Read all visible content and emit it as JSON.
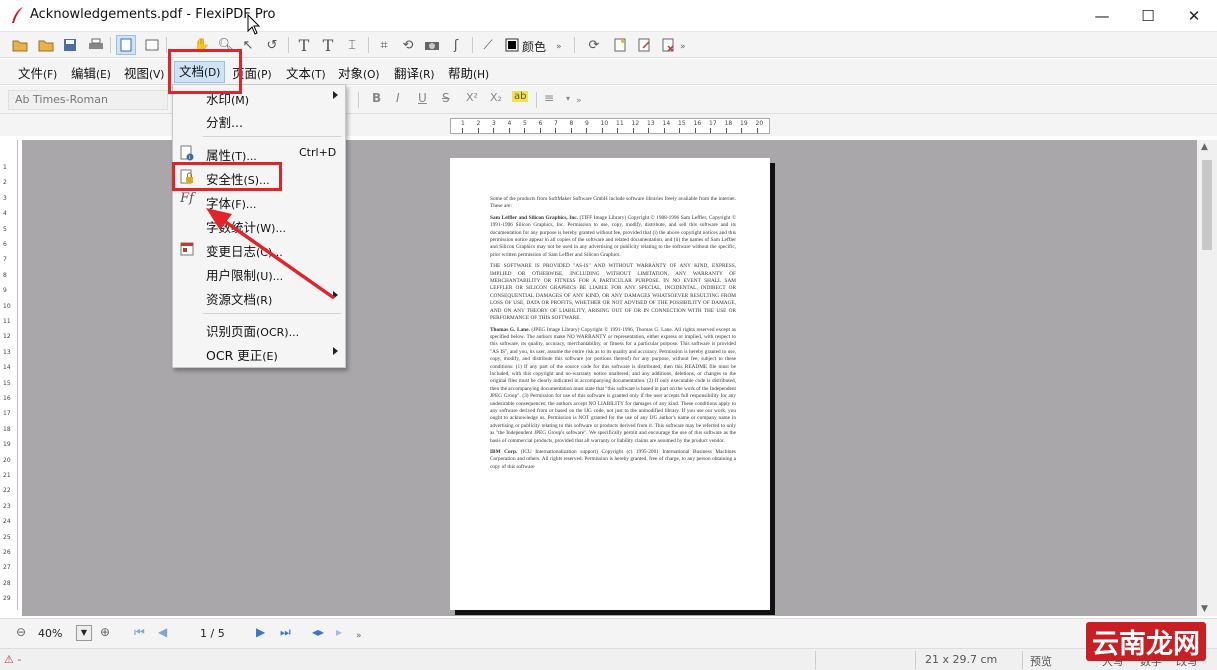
{
  "window": {
    "title": "Acknowledgements.pdf - FlexiPDF Pro",
    "min_label": "—",
    "max_label": "☐",
    "close_label": "✕"
  },
  "toolbar": {
    "color_label": "颜色",
    "more_label": "»"
  },
  "menubar": {
    "items": [
      {
        "label": "文件",
        "acc": "(F)"
      },
      {
        "label": "编辑",
        "acc": "(E)"
      },
      {
        "label": "视图",
        "acc": "(V)"
      },
      {
        "label": "文档",
        "acc": "(D)"
      },
      {
        "label": "页面",
        "acc": "(P)"
      },
      {
        "label": "文本",
        "acc": "(T)"
      },
      {
        "label": "对象",
        "acc": "(O)"
      },
      {
        "label": "翻译",
        "acc": "(R)"
      },
      {
        "label": "帮助",
        "acc": "(H)"
      }
    ]
  },
  "format_bar": {
    "font_name": "Ab Times-Roman",
    "bold": "B",
    "italic": "I",
    "underline": "U",
    "strike": "S",
    "superscript": "X²",
    "subscript": "X₂",
    "highlight": "ab",
    "more_label": "»"
  },
  "ruler": {
    "h_numbers": [
      "1",
      "2",
      "3",
      "4",
      "5",
      "6",
      "7",
      "8",
      "9",
      "10",
      "11",
      "12",
      "13",
      "14",
      "15",
      "16",
      "17",
      "18",
      "19",
      "20"
    ],
    "v_numbers": [
      "1",
      "2",
      "3",
      "4",
      "5",
      "6",
      "7",
      "8",
      "9",
      "10",
      "11",
      "12",
      "13",
      "14",
      "15",
      "16",
      "17",
      "18",
      "19",
      "20",
      "21",
      "22",
      "23",
      "24",
      "25",
      "26",
      "27",
      "28",
      "29"
    ]
  },
  "document_menu": {
    "items": [
      {
        "label": "水印",
        "acc": "(M)",
        "shortcut": "",
        "submenu": true
      },
      {
        "label": "分割...",
        "acc": "",
        "shortcut": "",
        "submenu": false
      },
      {
        "label": "属性",
        "acc": "(T)...",
        "shortcut": "Ctrl+D",
        "submenu": false
      },
      {
        "label": "安全性",
        "acc": "(S)...",
        "shortcut": "",
        "submenu": false
      },
      {
        "label": "字体",
        "acc": "(F)...",
        "shortcut": "",
        "submenu": false
      },
      {
        "label": "字数统计",
        "acc": "(W)...",
        "shortcut": "",
        "submenu": false
      },
      {
        "label": "变更日志",
        "acc": "(C)...",
        "shortcut": "",
        "submenu": false
      },
      {
        "label": "用户限制",
        "acc": "(U)...",
        "shortcut": "",
        "submenu": false
      },
      {
        "label": "资源文档",
        "acc": "(R)",
        "shortcut": "",
        "submenu": true
      },
      {
        "label": "识别页面",
        "acc": "(OCR)...",
        "shortcut": "",
        "submenu": false
      },
      {
        "label": "OCR 更正",
        "acc": "(E)",
        "shortcut": "",
        "submenu": true
      }
    ]
  },
  "pdf_page": {
    "paragraphs": [
      {
        "bold": "",
        "text": "Some of the products from SoftMaker Software GmbH include software libraries freely available from the internet. These are:"
      },
      {
        "bold": "Sam Leffler and Silicon Graphics, Inc.",
        "text": " (TIFF Image Library) Copyright © 1988-1996 Sam Leffler, Copyright © 1991-1996 Silicon Graphics, Inc. Permission to use, copy, modify, distribute, and sell this software and its documentation for any purpose is hereby granted without fee, provided that (i) the above copyright notices and this permission notice appear in all copies of the software and related documentation, and (ii) the names of Sam Leffler and Silicon Graphics may not be used in any advertising or publicity relating to the software without the specific, prior written permission of Sam Leffler and Silicon Graphics."
      },
      {
        "bold": "",
        "text": "THE SOFTWARE IS PROVIDED \"AS-IS\" AND WITHOUT WARRANTY OF ANY KIND, EXPRESS, IMPLIED OR OTHERWISE, INCLUDING WITHOUT LIMITATION, ANY WARRANTY OF MERCHANTABILITY OR FITNESS FOR A PARTICULAR PURPOSE. IN NO EVENT SHALL SAM LEFFLER OR SILICON GRAPHICS BE LIABLE FOR ANY SPECIAL, INCIDENTAL, INDIRECT OR CONSEQUENTIAL DAMAGES OF ANY KIND, OR ANY DAMAGES WHATSOEVER RESULTING FROM LOSS OF USE, DATA OR PROFITS, WHETHER OR NOT ADVISED OF THE POSSIBILITY OF DAMAGE, AND ON ANY THEORY OF LIABILITY, ARISING OUT OF OR IN CONNECTION WITH THE USE OR PERFORMANCE OF THIS SOFTWARE."
      },
      {
        "bold": "Thomas G. Lane.",
        "text": " (JPEG Image Library) Copyright © 1991-1996, Thomas G. Lane. All rights reserved except as specified below. The authors make NO WARRANTY or representation, either express or implied, with respect to this software, its quality, accuracy, merchantability, or fitness for a particular purpose. This software is provided \"AS IS\", and you, its user, assume the entire risk as to its quality and accuracy. Permission is hereby granted to use, copy, modify, and distribute this software (or portions thereof) for any purpose, without fee, subject to these conditions: (1) If any part of the source code for this software is distributed, then this README file must be included, with this copyright and no-warranty notice unaltered; and any additions, deletions, or changes to the original files must be clearly indicated in accompanying documentation. (2) If only executable code is distributed, then the accompanying documentation must state that \"this software is based in part on the work of the Independent JPEG Group\". (3) Permission for use of this software is granted only if the user accepts full responsibility for any undesirable consequences; the authors accept NO LIABILITY for damages of any kind. These conditions apply to any software derived from or based on the IJG code, not just to the unmodified library. If you use our work, you ought to acknowledge us. Permission is NOT granted for the use of any IJG author's name or company name in advertising or publicity relating to this software or products derived from it. This software may be referred to only as \"the Independent JPEG Group's software\". We specifically permit and encourage the use of this software as the basis of commercial products, provided that all warranty or liability claims are assumed by the product vendor."
      },
      {
        "bold": "IBM Corp.",
        "text": " (ICU Internationalization support) Copyright (c) 1995-2001 International Business Machines Corporation and others. All rights reserved. Permission is hereby granted, free of charge, to any person obtaining a copy of this software"
      }
    ]
  },
  "bottom_bar": {
    "zoom": "40%",
    "page_indicator": "1 / 5",
    "more_label": "»"
  },
  "status_bar": {
    "page_size": "21 x 29.7 cm",
    "mode": "预览",
    "caps": "大写",
    "num": "数字",
    "overwrite": "改写"
  },
  "watermark": {
    "text": "云南龙网"
  },
  "colors": {
    "highlight_red": "#e0242a",
    "menu_active_bg": "#cfe3f7",
    "doc_background": "#a9a7aa"
  }
}
